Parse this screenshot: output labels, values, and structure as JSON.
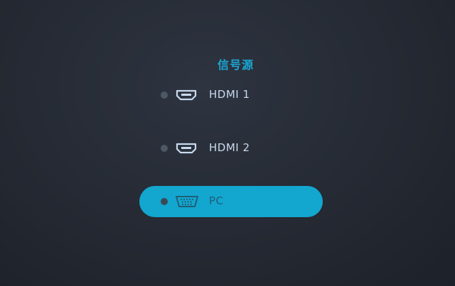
{
  "osd": {
    "title": "信号源",
    "accent_color": "#13a6cf",
    "items": [
      {
        "label": "HDMI 1",
        "icon": "hdmi-port-icon",
        "selected": false
      },
      {
        "label": "HDMI 2",
        "icon": "hdmi-port-icon",
        "selected": false
      },
      {
        "label": "PC",
        "icon": "vga-port-icon",
        "selected": true
      }
    ]
  }
}
